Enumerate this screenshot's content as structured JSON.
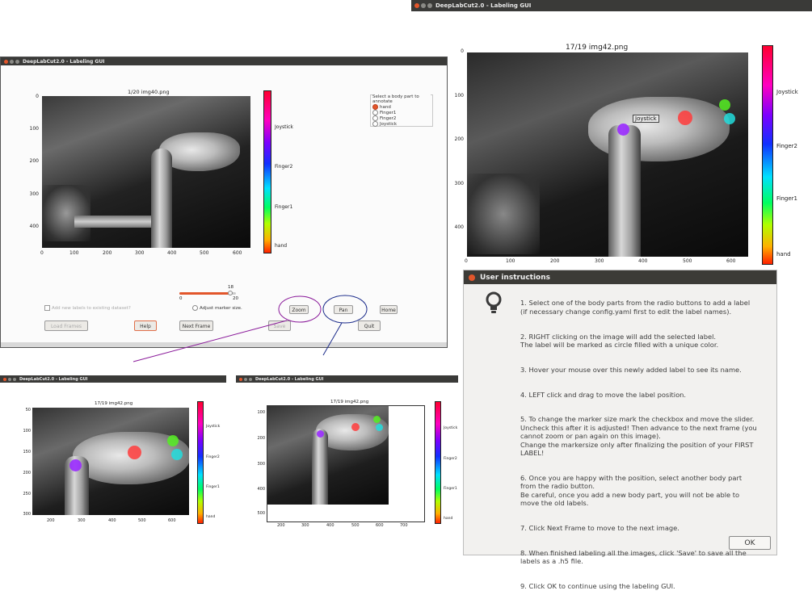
{
  "top_window": {
    "title": "DeepLabCut2.0 - Labeling GUI"
  },
  "right_plot": {
    "title": "17/19 img42.png",
    "yticks": [
      "0",
      "100",
      "200",
      "300",
      "400"
    ],
    "xticks": [
      "0",
      "100",
      "200",
      "300",
      "400",
      "500",
      "600"
    ],
    "tooltip": "Joystick",
    "colorbar_labels": [
      "Joystick",
      "Finger2",
      "Finger1",
      "hand"
    ]
  },
  "main_window": {
    "title": "DeepLabCut2.0 - Labeling GUI",
    "plot_title": "1/20 img40.png",
    "yticks": [
      "0",
      "100",
      "200",
      "300",
      "400"
    ],
    "xticks": [
      "0",
      "100",
      "200",
      "300",
      "400",
      "500",
      "600"
    ],
    "colorbar_labels": [
      "Joystick",
      "Finger2",
      "Finger1",
      "hand"
    ],
    "bodypart_box_title": "Select a body part to annotate",
    "bodyparts": [
      "hand",
      "Finger1",
      "Finger2",
      "Joystick"
    ],
    "slider": {
      "value": "18",
      "min": "0",
      "max": "20",
      "fraction": 0.9
    },
    "add_new_labels": "Add new labels to existing dataset?",
    "adjust_marker": "Adjust marker size.",
    "buttons": {
      "zoom": "Zoom",
      "pan": "Pan",
      "home": "Home",
      "load": "Load Frames",
      "help": "Help",
      "next": "Next Frame",
      "save": "Save",
      "quit": "Quit"
    }
  },
  "zoom_window": {
    "title": "DeepLabCut2.0 - Labeling GUI",
    "plot_title": "17/19 img42.png",
    "yticks": [
      "50",
      "100",
      "150",
      "200",
      "250",
      "300"
    ],
    "xticks": [
      "200",
      "300",
      "400",
      "500",
      "600"
    ],
    "colorbar_labels": [
      "Joystick",
      "Finger2",
      "Finger1",
      "hand"
    ]
  },
  "pan_window": {
    "title": "DeepLabCut2.0 - Labeling GUI",
    "plot_title": "17/19 img42.png",
    "yticks": [
      "100",
      "200",
      "300",
      "400",
      "500"
    ],
    "xticks": [
      "200",
      "300",
      "400",
      "500",
      "600",
      "700"
    ],
    "colorbar_labels": [
      "Joystick",
      "Finger2",
      "Finger1",
      "hand"
    ]
  },
  "dialog": {
    "title": "User instructions",
    "icon": "lightbulb-icon",
    "instructions": [
      "1. Select one of the body parts from the radio buttons to add a label\n(if necessary change config.yaml first to edit the label names).",
      "2. RIGHT clicking on the image will add the selected label.\n The label will be marked as circle filled with a unique color.",
      "3. Hover your mouse over this newly added label to see its name.",
      "4. LEFT click and drag to move the label position.",
      "5. To change the marker size mark the checkbox and move the slider.\nUncheck this after it is adjusted! Then advance to the next frame (you\ncannot zoom or pan again on this image).\n Change the markersize only after finalizing the position of your FIRST\nLABEL!",
      "6. Once you are happy with the position, select another body part\nfrom the radio button.\n Be careful, once you add a new body part, you will not be able to\nmove the old labels.",
      "7. Click Next Frame to move to the next image.",
      "8. When finished labeling all the images, click 'Save' to save all the\nlabels as a .h5 file.",
      "9. Click OK to continue using the labeling GUI."
    ],
    "ok_label": "OK"
  },
  "colors": {
    "hand": "#ff3b3b",
    "finger1": "#55ee22",
    "finger2": "#22dddd",
    "joystick": "#9a2bff",
    "zoom_ellipse": "#8a1a9a",
    "pan_ellipse": "#1a2a8a"
  }
}
